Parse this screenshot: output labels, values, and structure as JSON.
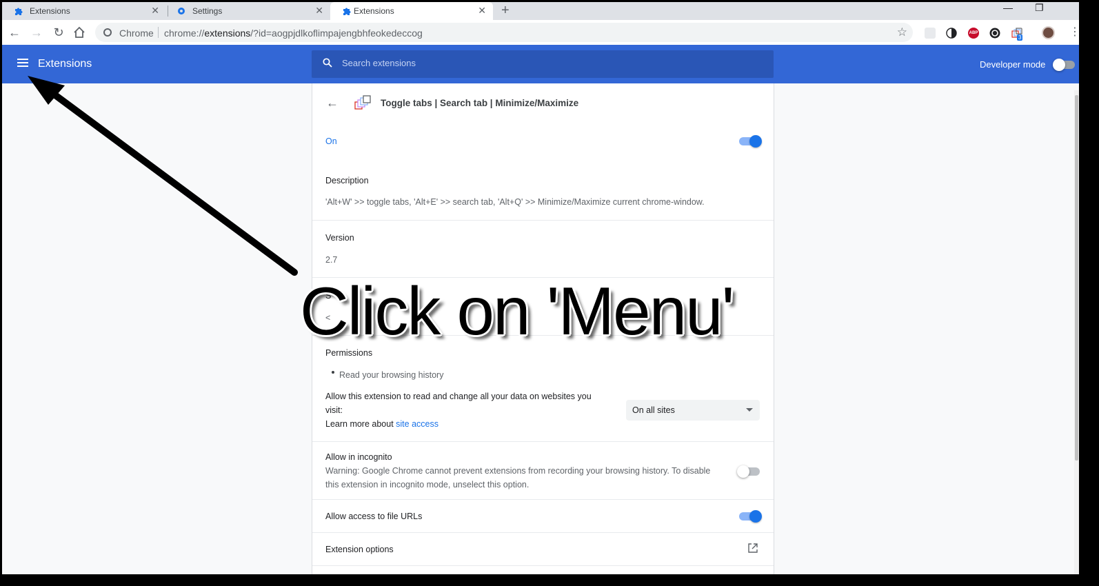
{
  "browser": {
    "tabs": [
      {
        "label": "Extensions",
        "icon": "puzzle-icon"
      },
      {
        "label": "Settings",
        "icon": "gear-icon"
      },
      {
        "label": "Extensions",
        "icon": "puzzle-icon",
        "active": true
      }
    ],
    "new_tab": "+",
    "omnibox": {
      "site_label": "Chrome",
      "url_prefix": "chrome://",
      "url_host": "extensions",
      "url_rest": "/?id=aogpjdlkoflimpajengbhfeokedeccog"
    },
    "extension_badge": "3",
    "icons": [
      "back-icon",
      "forward-icon",
      "reload-icon",
      "home-icon",
      "star-icon",
      "kebab-icon"
    ]
  },
  "header": {
    "title": "Extensions",
    "search_placeholder": "Search extensions",
    "developer_mode_label": "Developer mode",
    "developer_mode_on": false,
    "accent": "#3367d6"
  },
  "detail": {
    "name": "Toggle tabs | Search tab | Minimize/Maximize",
    "status": "On",
    "enabled": true,
    "description_label": "Description",
    "description": "'Alt+W' >> toggle tabs, 'Alt+E' >> search tab, 'Alt+Q' >> Minimize/Maximize current chrome-window.",
    "version_label": "Version",
    "version": "2.7",
    "hidden_row_label": "S",
    "hidden_row_value": "<",
    "permissions_label": "Permissions",
    "permissions": [
      "Read your browsing history"
    ],
    "site_access_line1": "Allow this extension to read and change all your data on websites you",
    "site_access_line2": "visit:",
    "learn_more_prefix": "Learn more about ",
    "learn_more_link": "site access",
    "site_access_value": "On all sites",
    "incognito_label": "Allow in incognito",
    "incognito_warning_line1": "Warning: Google Chrome cannot prevent extensions from recording your browsing history. To disable",
    "incognito_warning_line2": "this extension in incognito mode, unselect this option.",
    "incognito_on": false,
    "file_urls_label": "Allow access to file URLs",
    "file_urls_on": true,
    "options_label": "Extension options"
  },
  "annotation": {
    "text": "Click on 'Menu'"
  }
}
